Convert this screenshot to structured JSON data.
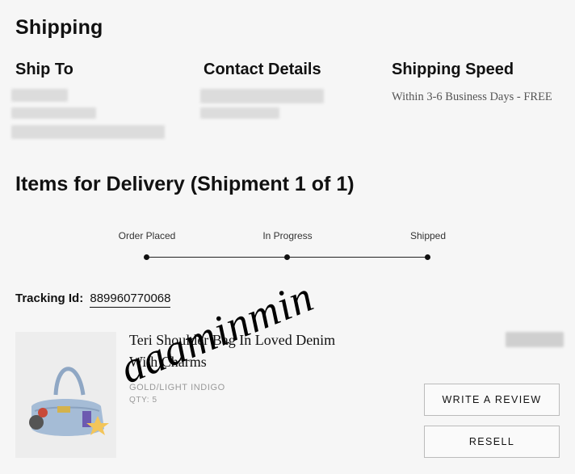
{
  "shipping": {
    "title": "Shipping",
    "ship_to_title": "Ship To",
    "contact_title": "Contact Details",
    "speed_title": "Shipping Speed",
    "speed_text": "Within 3-6 Business Days - FREE"
  },
  "delivery": {
    "title": "Items for Delivery (Shipment 1 of 1)",
    "timeline": [
      "Order Placed",
      "In Progress",
      "Shipped"
    ],
    "tracking_label": "Tracking Id:",
    "tracking_number": "889960770068"
  },
  "item": {
    "name": "Teri Shoulder Bag In Loved Denim With Charms",
    "color": "GOLD/LIGHT INDIGO",
    "qty": "QTY: 5",
    "image_icon": "denim-shoulder-bag-image"
  },
  "actions": {
    "review": "WRITE A REVIEW",
    "resell": "RESELL"
  },
  "watermark": "aaaminmin"
}
